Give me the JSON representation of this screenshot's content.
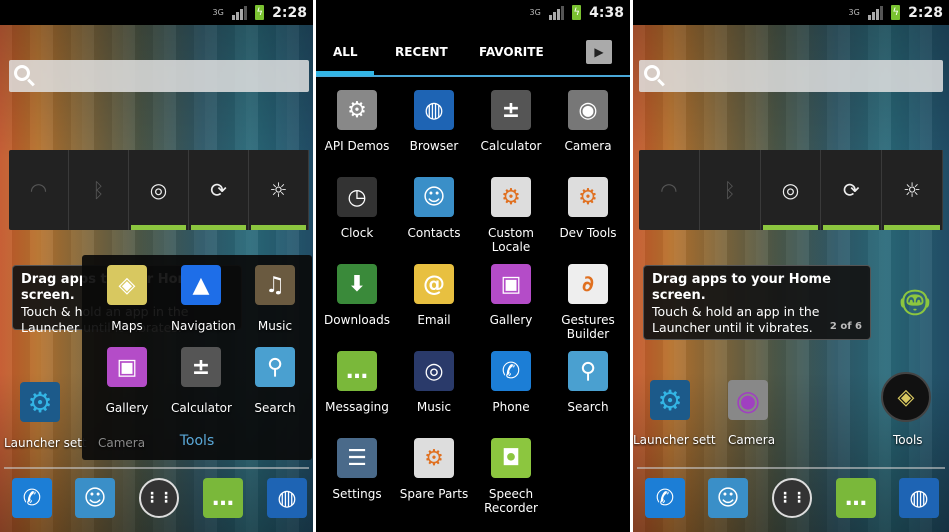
{
  "status": {
    "left_time": "2:28",
    "middle_time": "4:38",
    "right_time": "2:28",
    "network": "3G"
  },
  "widget_icons": [
    "wifi-icon",
    "bluetooth-icon",
    "gps-icon",
    "sync-icon",
    "brightness-icon"
  ],
  "widget_glyphs": [
    "◠",
    "ᛒ",
    "◎",
    "⟳",
    "☼"
  ],
  "tooltip": {
    "title": "Drag apps to your Home screen.",
    "body": "Touch & hold an app in the Launcher until it vibrates.",
    "page": "2 of 6"
  },
  "left": {
    "launcher_settings": "Launcher sett",
    "camera": "Camera",
    "folder": {
      "name": "Tools",
      "apps": [
        {
          "label": "Maps",
          "icon": "maps-icon",
          "color": "#d8c860",
          "glyph": "◈"
        },
        {
          "label": "Navigation",
          "icon": "navigation-arrow-icon",
          "color": "#1e6ee8",
          "glyph": "▲"
        },
        {
          "label": "Music",
          "icon": "headphones-icon",
          "color": "#6a5a40",
          "glyph": "♫"
        },
        {
          "label": "Gallery",
          "icon": "gallery-icon",
          "color": "#b44cc8",
          "glyph": "▣"
        },
        {
          "label": "Calculator",
          "icon": "calculator-icon",
          "color": "#555",
          "glyph": "±"
        },
        {
          "label": "Search",
          "icon": "magnifier-icon",
          "color": "#4aa0d0",
          "glyph": "⚲"
        }
      ]
    }
  },
  "dock": [
    {
      "name": "phone",
      "icon": "phone-icon",
      "color": "#1c7ed6",
      "glyph": "✆"
    },
    {
      "name": "contacts",
      "icon": "contacts-icon",
      "color": "#3a8fc8",
      "glyph": "☺"
    },
    {
      "name": "app-drawer",
      "icon": "app-grid-icon",
      "color": "#333",
      "glyph": "⋮⋮"
    },
    {
      "name": "messaging",
      "icon": "messaging-icon",
      "color": "#7ab83a",
      "glyph": "…"
    },
    {
      "name": "browser",
      "icon": "globe-icon",
      "color": "#1e64b4",
      "glyph": "◍"
    }
  ],
  "drawer": {
    "tabs": [
      "ALL",
      "RECENT",
      "FAVORITE"
    ],
    "store_icon": "play-store-bag-icon",
    "apps": [
      {
        "label": "API Demos",
        "icon": "folder-gear-icon",
        "color": "#888",
        "glyph": "⚙"
      },
      {
        "label": "Browser",
        "icon": "globe-icon",
        "color": "#1e64b4",
        "glyph": "◍"
      },
      {
        "label": "Calculator",
        "icon": "calculator-icon",
        "color": "#555",
        "glyph": "±"
      },
      {
        "label": "Camera",
        "icon": "camera-icon",
        "color": "#777",
        "glyph": "◉"
      },
      {
        "label": "Clock",
        "icon": "clock-icon",
        "color": "#333",
        "glyph": "◷"
      },
      {
        "label": "Contacts",
        "icon": "contacts-icon",
        "color": "#3a8fc8",
        "glyph": "☺"
      },
      {
        "label": "Custom Locale",
        "icon": "gear-icon",
        "color": "#ddd",
        "glyph": "⚙"
      },
      {
        "label": "Dev Tools",
        "icon": "gear-icon",
        "color": "#ddd",
        "glyph": "⚙"
      },
      {
        "label": "Downloads",
        "icon": "download-icon",
        "color": "#3a8a3a",
        "glyph": "⬇"
      },
      {
        "label": "Email",
        "icon": "email-icon",
        "color": "#e8c040",
        "glyph": "@"
      },
      {
        "label": "Gallery",
        "icon": "gallery-icon",
        "color": "#b44cc8",
        "glyph": "▣"
      },
      {
        "label": "Gestures Builder",
        "icon": "gestures-icon",
        "color": "#eee",
        "glyph": "∂"
      },
      {
        "label": "Messaging",
        "icon": "messaging-icon",
        "color": "#7ab83a",
        "glyph": "…"
      },
      {
        "label": "Music",
        "icon": "speaker-icon",
        "color": "#2a3a6a",
        "glyph": "◎"
      },
      {
        "label": "Phone",
        "icon": "phone-icon",
        "color": "#1c7ed6",
        "glyph": "✆"
      },
      {
        "label": "Search",
        "icon": "magnifier-icon",
        "color": "#4aa0d0",
        "glyph": "⚲"
      },
      {
        "label": "Settings",
        "icon": "settings-sliders-icon",
        "color": "#4a6a8a",
        "glyph": "☰"
      },
      {
        "label": "Spare Parts",
        "icon": "gear-icon",
        "color": "#ddd",
        "glyph": "⚙"
      },
      {
        "label": "Speech Recorder",
        "icon": "android-icon",
        "color": "#8cc63f",
        "glyph": "◘"
      }
    ]
  },
  "right": {
    "launcher_settings": "Launcher sett",
    "camera": "Camera",
    "tools": "Tools"
  }
}
